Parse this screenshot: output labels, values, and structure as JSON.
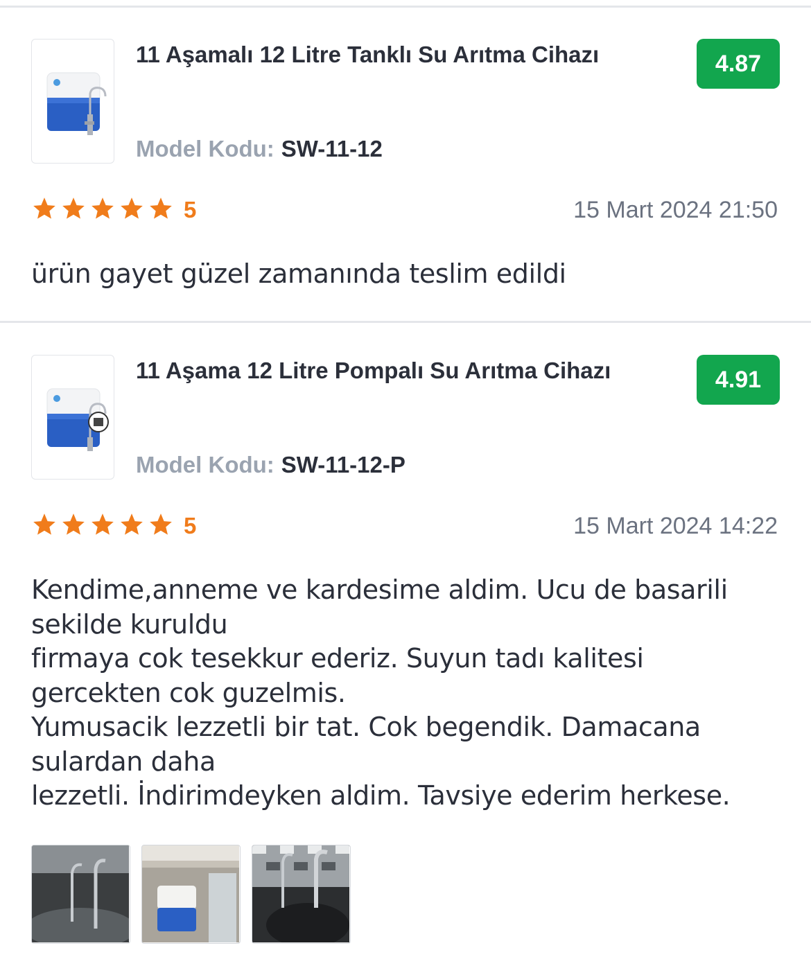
{
  "reviews": [
    {
      "product_title": "11 Aşamalı 12 Litre Tanklı Su Arıtma Cihazı",
      "model_label": "Model Kodu:",
      "model_code": "SW-11-12",
      "score": "4.87",
      "rating": "5",
      "stars": 5,
      "date": "15 Mart 2024 21:50",
      "comment": "ürün gayet güzel zamanında teslim edildi"
    },
    {
      "product_title": "11 Aşama 12 Litre Pompalı Su Arıtma Cihazı",
      "model_label": "Model Kodu:",
      "model_code": "SW-11-12-P",
      "score": "4.91",
      "rating": "5",
      "stars": 5,
      "date": "15 Mart 2024 14:22",
      "comment": "Kendime,anneme ve kardesime aldim. Ucu de basarili\nsekilde kuruldu\nfirmaya cok tesekkur ederiz. Suyun tadı kalitesi\ngercekten cok guzelmis.\nYumusacik lezzetli bir tat. Cok begendik. Damacana\nsulardan daha\nlezzetli. İndirimdeyken aldim. Tavsiye ederim herkese."
    }
  ],
  "colors": {
    "score_badge": "#12a64e",
    "star": "#f07c1b",
    "label_gray": "#9aa3b0",
    "text": "#2b2f3a"
  },
  "icons": [
    "star-icon",
    "product-thumbnail",
    "review-photo"
  ]
}
